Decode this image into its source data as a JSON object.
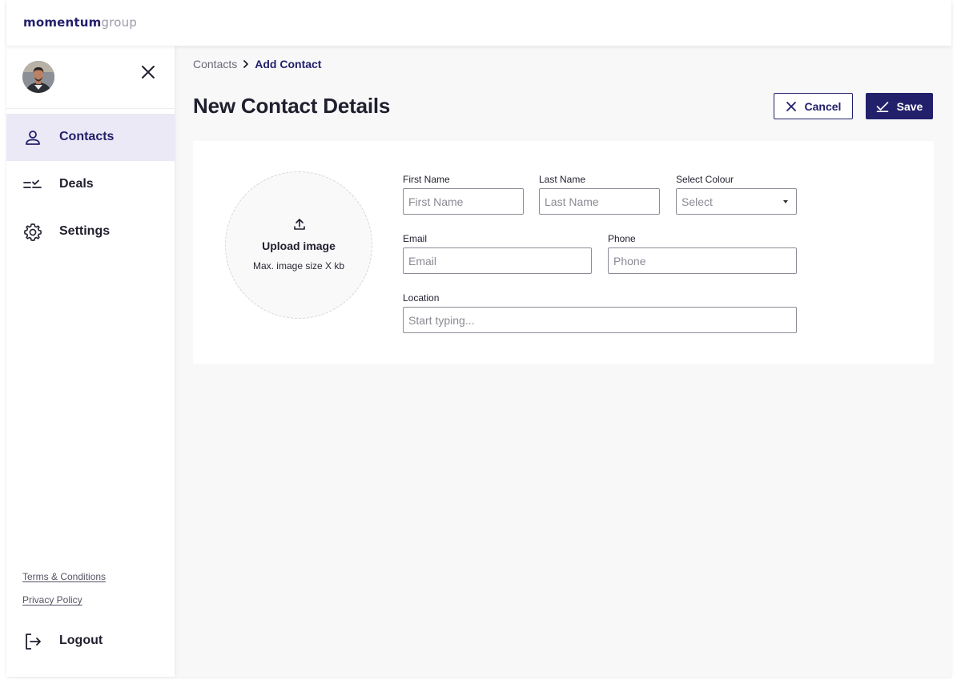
{
  "header": {
    "logo_strong": "momentum",
    "logo_light": "group"
  },
  "sidebar": {
    "items": [
      {
        "label": "Contacts",
        "icon": "person-icon",
        "active": true
      },
      {
        "label": "Deals",
        "icon": "checklist-icon",
        "active": false
      },
      {
        "label": "Settings",
        "icon": "gear-icon",
        "active": false
      }
    ],
    "links": {
      "terms": "Terms & Conditions",
      "privacy": "Privacy Policy"
    },
    "logout": {
      "label": "Logout",
      "icon": "logout-icon"
    }
  },
  "breadcrumb": {
    "parent": "Contacts",
    "current": "Add Contact"
  },
  "page": {
    "title": "New Contact Details"
  },
  "actions": {
    "cancel_label": "Cancel",
    "save_label": "Save"
  },
  "upload": {
    "title": "Upload image",
    "subtitle": "Max. image size X kb"
  },
  "form": {
    "first_name": {
      "label": "First Name",
      "placeholder": "First Name",
      "value": ""
    },
    "last_name": {
      "label": "Last Name",
      "placeholder": "Last Name",
      "value": ""
    },
    "colour": {
      "label": "Select Colour",
      "selected": "Select"
    },
    "email": {
      "label": "Email",
      "placeholder": "Email",
      "value": ""
    },
    "phone": {
      "label": "Phone",
      "placeholder": "Phone",
      "value": ""
    },
    "location": {
      "label": "Location",
      "placeholder": "Start typing...",
      "value": ""
    }
  },
  "colors": {
    "brand": "#23206b",
    "active_bg": "#ebe9f6",
    "page_bg": "#f8f8f9"
  }
}
